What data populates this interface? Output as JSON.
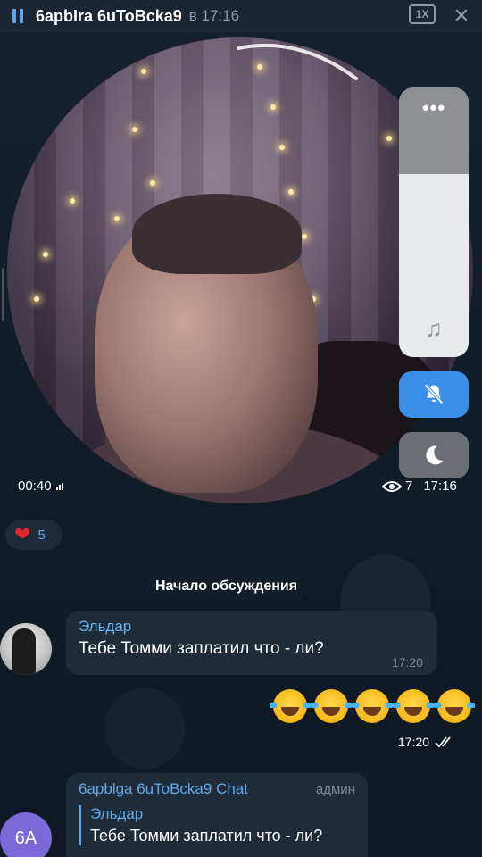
{
  "topbar": {
    "title": "6apbIra 6uToBcka9",
    "meta": "в 17:16",
    "speed": "1X",
    "pause_icon": "pause-icon",
    "close_icon": "close-icon"
  },
  "video": {
    "duration": "00:40",
    "views": "7",
    "time": "17:16",
    "volume_level": 0.68
  },
  "controls": {
    "more_icon": "more-dots-icon",
    "more_label": "•••",
    "music_icon": "music-note-icon",
    "music_glyph": "♫",
    "mute_icon": "bell-muted-icon",
    "sleep_icon": "moon-icon"
  },
  "reaction": {
    "emoji": "❤",
    "count": "5"
  },
  "service_message": "Начало обсуждения",
  "messages": [
    {
      "sender": "Эльдар",
      "text": "Тебе Томми заплатил что - ли?",
      "time": "17:20"
    },
    {
      "emoji_count": 5,
      "time": "17:20"
    },
    {
      "sender": "6apblga 6uToBcka9 Chat",
      "role": "админ",
      "avatar_initials": "6A",
      "reply_sender": "Эльдар",
      "reply_text": "Тебе Томми заплатил что - ли?"
    }
  ],
  "colors": {
    "accent": "#5fa8ea",
    "background": "#0e1621",
    "bubble": "#1e2b39",
    "mute_button": "#3b8fe8",
    "heart": "#e0262e"
  }
}
